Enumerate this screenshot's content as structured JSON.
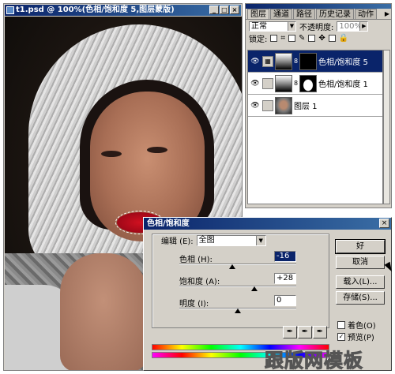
{
  "document": {
    "title": "t1.psd @ 100%(色相/饱和度 5,图层蒙版)",
    "buttons": [
      "_",
      "□",
      "×"
    ]
  },
  "layers_panel": {
    "tabs": [
      "图层",
      "通道",
      "路径",
      "历史记录",
      "动作"
    ],
    "active_tab": "图层",
    "blend_mode": "正常",
    "opacity_label": "不透明度:",
    "opacity_value": "100%",
    "lock_label": "锁定:",
    "layers": [
      {
        "name": "色相/饱和度 5",
        "selected": true
      },
      {
        "name": "色相/饱和度 1",
        "selected": false
      },
      {
        "name": "图层 1",
        "selected": false
      }
    ]
  },
  "dialog": {
    "title": "色相/饱和度",
    "close": "×",
    "edit_label": "编辑 (E):",
    "edit_value": "全图",
    "hue_label": "色相 (H):",
    "hue_value": "-16",
    "hue_level": -16,
    "saturation_label": "饱和度 (A):",
    "saturation_value": "+28",
    "saturation_level": 28,
    "lightness_label": "明度 (I):",
    "lightness_value": "0",
    "lightness_level": 0,
    "ok": "好",
    "cancel": "取消",
    "load": "载入(L)...",
    "save": "存储(S)...",
    "colorize_label": "着色(O)",
    "colorize_checked": false,
    "preview_label": "预览(P)",
    "preview_checked": true
  },
  "watermark": "跟版网模板"
}
